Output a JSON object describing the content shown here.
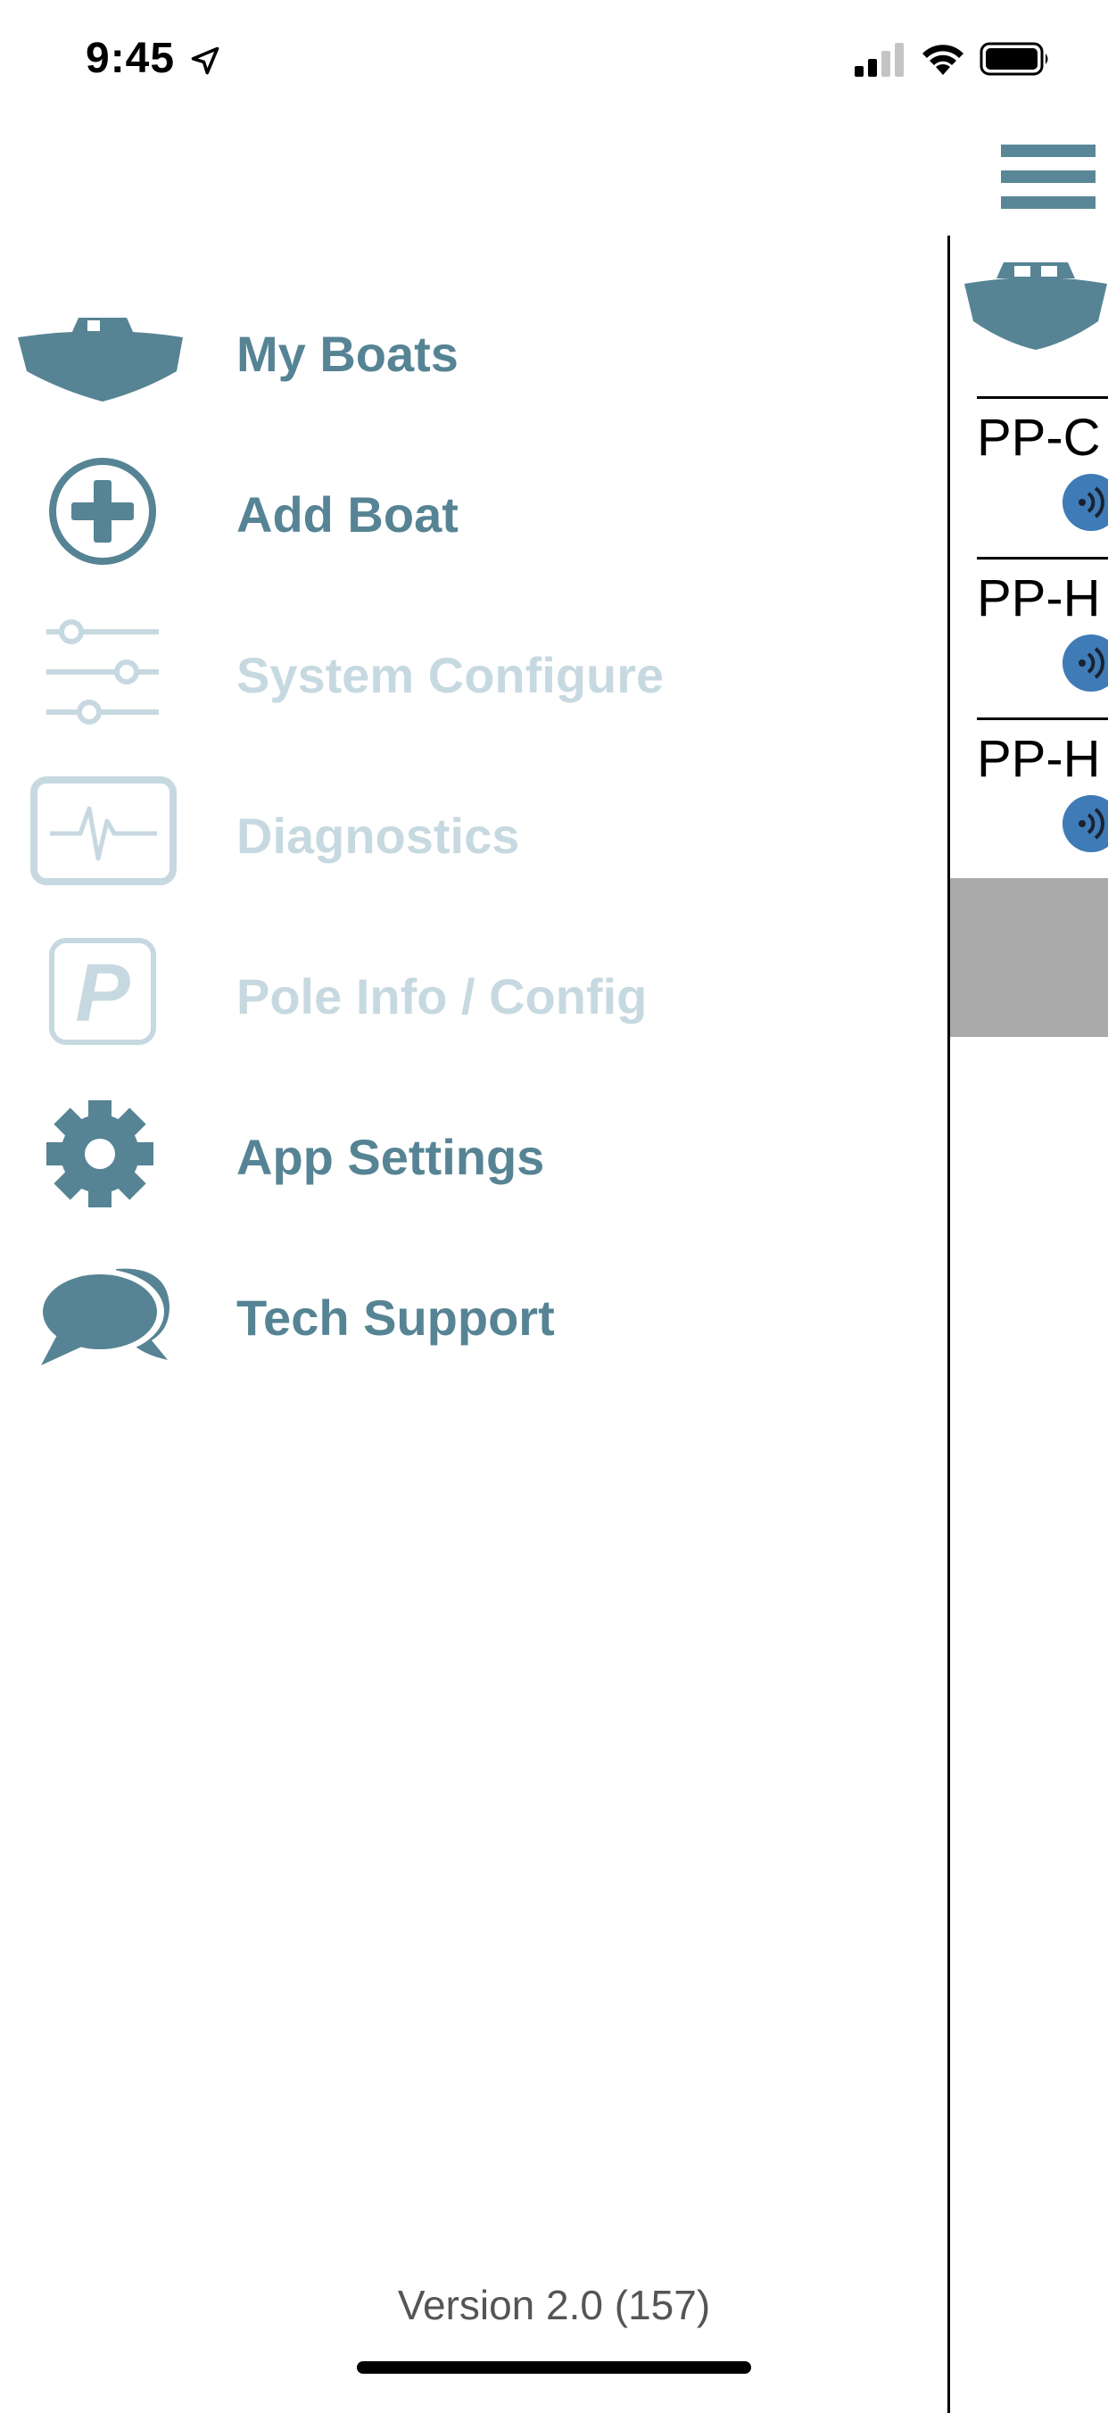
{
  "status_bar": {
    "time": "9:45",
    "icons": [
      "location-arrow-icon",
      "cellular-signal-icon",
      "wifi-icon",
      "battery-icon"
    ]
  },
  "menu": {
    "items": [
      {
        "label": "My Boats",
        "icon": "boat-icon",
        "enabled": true
      },
      {
        "label": "Add Boat",
        "icon": "plus-circle-icon",
        "enabled": true
      },
      {
        "label": "System Configure",
        "icon": "sliders-icon",
        "enabled": false
      },
      {
        "label": "Diagnostics",
        "icon": "heartbeat-monitor-icon",
        "enabled": false
      },
      {
        "label": "Pole Info / Config",
        "icon": "p-badge-icon",
        "enabled": false
      },
      {
        "label": "App Settings",
        "icon": "gear-icon",
        "enabled": true
      },
      {
        "label": "Tech Support",
        "icon": "chat-bubbles-icon",
        "enabled": true
      }
    ],
    "version": "Version 2.0 (157)"
  },
  "background_screen": {
    "rows": [
      {
        "name": "PP-C"
      },
      {
        "name": "PP-H"
      },
      {
        "name": "PP-H"
      }
    ]
  },
  "colors": {
    "accent": "#568494",
    "disabled": "#c7d9e0",
    "badge": "#3f7bb6"
  }
}
